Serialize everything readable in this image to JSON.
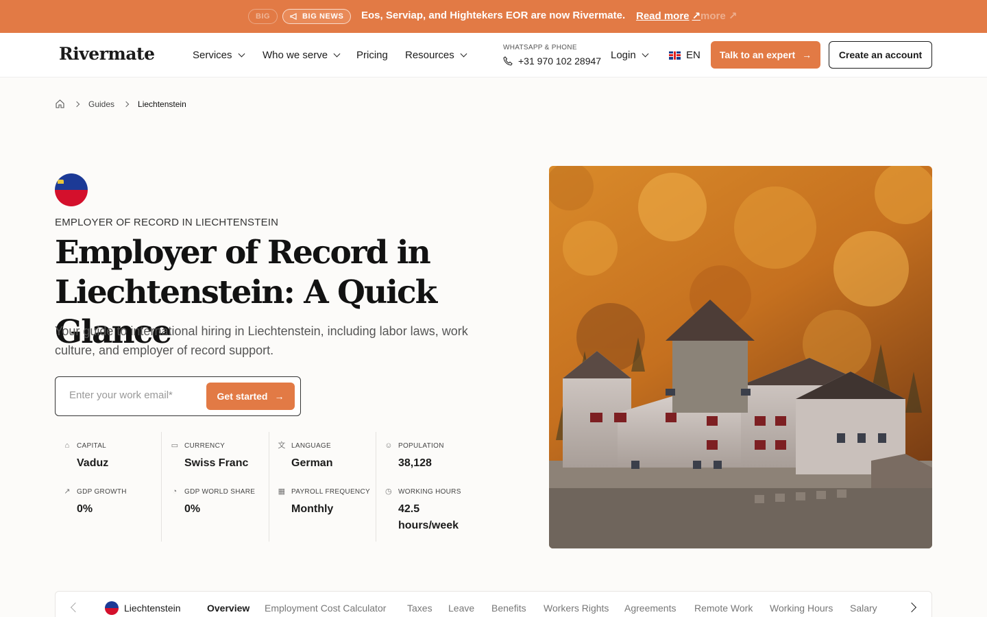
{
  "announcement": {
    "badge": "BIG NEWS",
    "ghost_badge": "BIG",
    "text": "Eos, Serviap, and Hightekers EOR are now Rivermate.",
    "link": "Read more",
    "ghost_link": "more"
  },
  "header": {
    "logo": "Rivermate",
    "nav": [
      "Services",
      "Who we serve",
      "Pricing",
      "Resources"
    ],
    "phone_label": "WHATSAPP & PHONE",
    "phone": "+31 970 102 28947",
    "login": "Login",
    "language": "EN",
    "cta_primary": "Talk to an expert",
    "cta_secondary": "Create an account"
  },
  "breadcrumb": {
    "items": [
      "Guides",
      "Liechtenstein"
    ]
  },
  "hero": {
    "eyebrow": "EMPLOYER OF RECORD IN LIECHTENSTEIN",
    "title": "Employer of Record in Liechtenstein: A Quick Glance",
    "subtitle": "Your guide to international hiring in Liechtenstein, including labor laws, work culture, and employer of record support.",
    "email_placeholder": "Enter your work email*",
    "cta": "Get started"
  },
  "stats": {
    "capital": {
      "label": "CAPITAL",
      "value": "Vaduz",
      "icon": "bank-icon"
    },
    "currency": {
      "label": "CURRENCY",
      "value": "Swiss Franc",
      "icon": "money-icon"
    },
    "language": {
      "label": "LANGUAGE",
      "value": "German",
      "icon": "translate-icon"
    },
    "population": {
      "label": "POPULATION",
      "value": "38,128",
      "icon": "people-icon"
    },
    "gdp_growth": {
      "label": "GDP GROWTH",
      "value": "0%",
      "icon": "trend-up-icon"
    },
    "gdp_share": {
      "label": "GDP WORLD SHARE",
      "value": "0%",
      "icon": "pie-icon"
    },
    "payroll": {
      "label": "PAYROLL FREQUENCY",
      "value": "Monthly",
      "icon": "calendar-icon"
    },
    "hours": {
      "label": "WORKING HOURS",
      "value": "42.5 hours/week",
      "icon": "clock-icon"
    }
  },
  "tabs": {
    "country": "Liechtenstein",
    "items": [
      "Overview",
      "Employment Cost Calculator",
      "Taxes",
      "Leave",
      "Benefits",
      "Workers Rights",
      "Agreements",
      "Remote Work",
      "Working Hours",
      "Salary"
    ],
    "active": "Overview"
  },
  "colors": {
    "accent": "#e27a45",
    "flag_blue": "#1c3a96",
    "flag_red": "#d4102c"
  }
}
